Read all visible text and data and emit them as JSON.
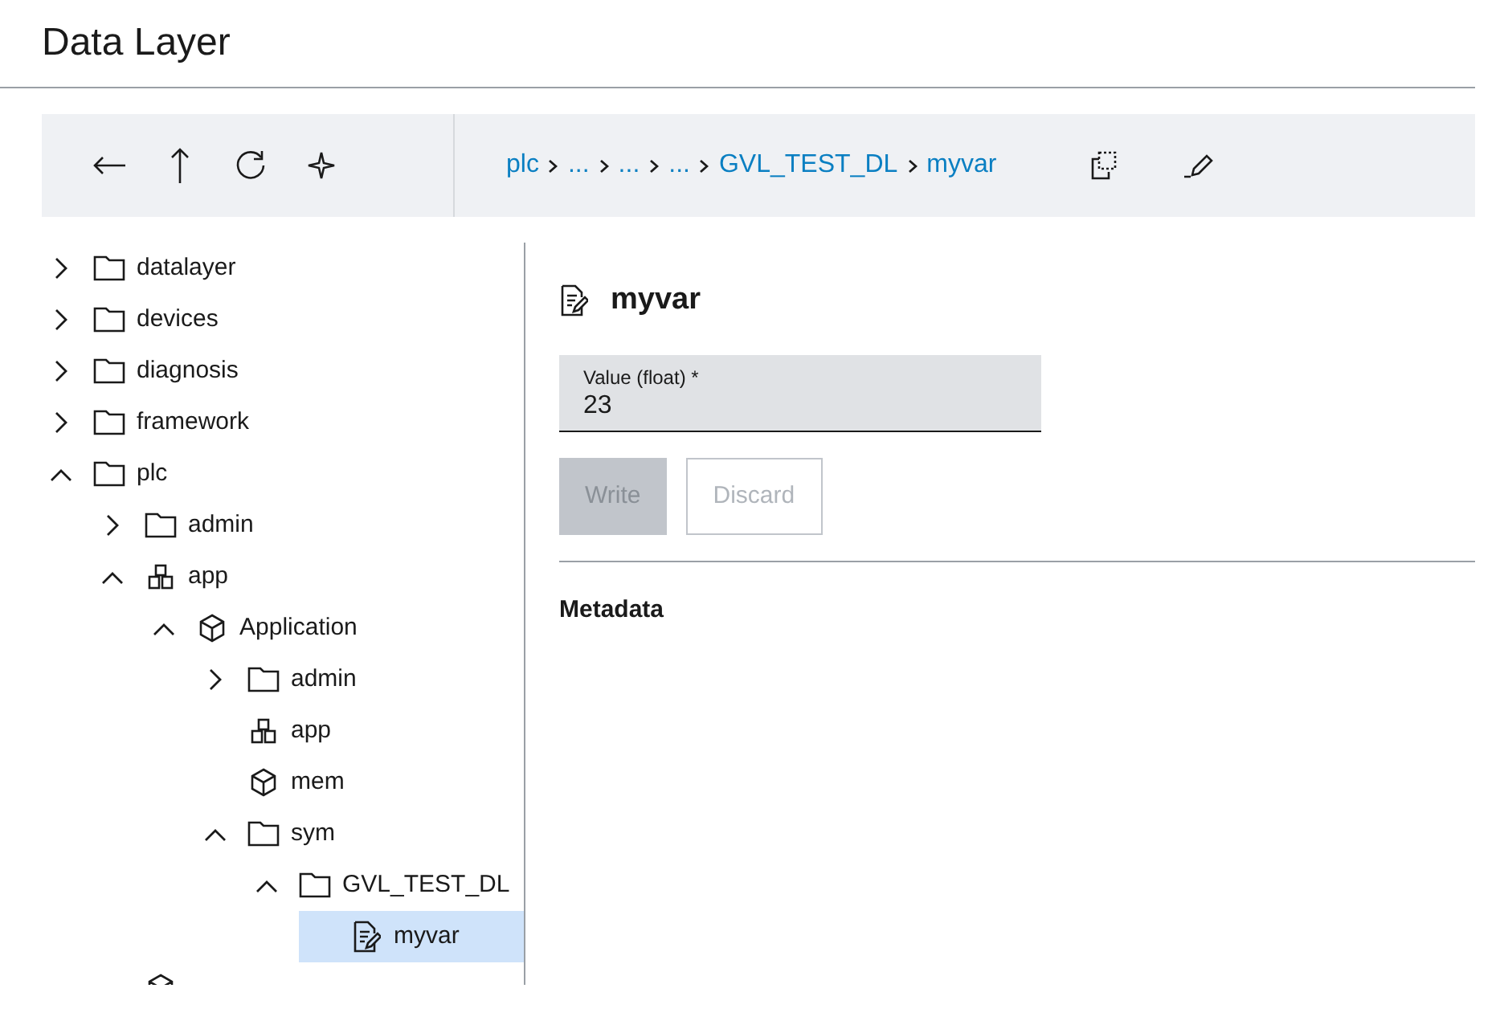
{
  "header": {
    "title": "Data Layer"
  },
  "toolbar": {
    "buttons": [
      {
        "kind": "back"
      },
      {
        "kind": "up"
      },
      {
        "kind": "refresh"
      },
      {
        "kind": "sparkle"
      }
    ],
    "breadcrumb": [
      "plc",
      "...",
      "...",
      "...",
      "GVL_TEST_DL",
      "myvar"
    ],
    "actions": [
      {
        "kind": "copy"
      },
      {
        "kind": "edit"
      }
    ]
  },
  "tree": [
    {
      "label": "datalayer",
      "kind": "folder",
      "expanded": false,
      "selected": false
    },
    {
      "label": "devices",
      "kind": "folder",
      "expanded": false,
      "selected": false
    },
    {
      "label": "diagnosis",
      "kind": "folder",
      "expanded": false,
      "selected": false
    },
    {
      "label": "framework",
      "kind": "folder",
      "expanded": false,
      "selected": false
    },
    {
      "label": "plc",
      "kind": "folder",
      "expanded": true,
      "selected": false,
      "children": [
        {
          "label": "admin",
          "kind": "folder",
          "expanded": false,
          "selected": false
        },
        {
          "label": "app",
          "kind": "app",
          "expanded": true,
          "selected": false,
          "children": [
            {
              "label": "Application",
              "kind": "cube",
              "expanded": true,
              "selected": false,
              "children": [
                {
                  "label": "admin",
                  "kind": "folder",
                  "expanded": false,
                  "selected": false
                },
                {
                  "label": "app",
                  "kind": "app",
                  "selected": false
                },
                {
                  "label": "mem",
                  "kind": "cube",
                  "selected": false
                },
                {
                  "label": "sym",
                  "kind": "folder",
                  "expanded": true,
                  "selected": false,
                  "children": [
                    {
                      "label": "GVL_TEST_DL",
                      "kind": "folder",
                      "expanded": true,
                      "selected": false,
                      "children": [
                        {
                          "label": "myvar",
                          "kind": "variable",
                          "selected": true
                        }
                      ]
                    }
                  ]
                }
              ]
            }
          ]
        },
        {
          "kind": "cube",
          "selected": false
        }
      ]
    }
  ],
  "detail": {
    "title": "myvar",
    "field": {
      "label": "Value (float) *",
      "value": "23"
    },
    "buttons": [
      {
        "label": "Write",
        "kind": "primary",
        "disabled": true
      },
      {
        "label": "Discard",
        "kind": "secondary",
        "disabled": true
      }
    ],
    "section": "Metadata"
  }
}
